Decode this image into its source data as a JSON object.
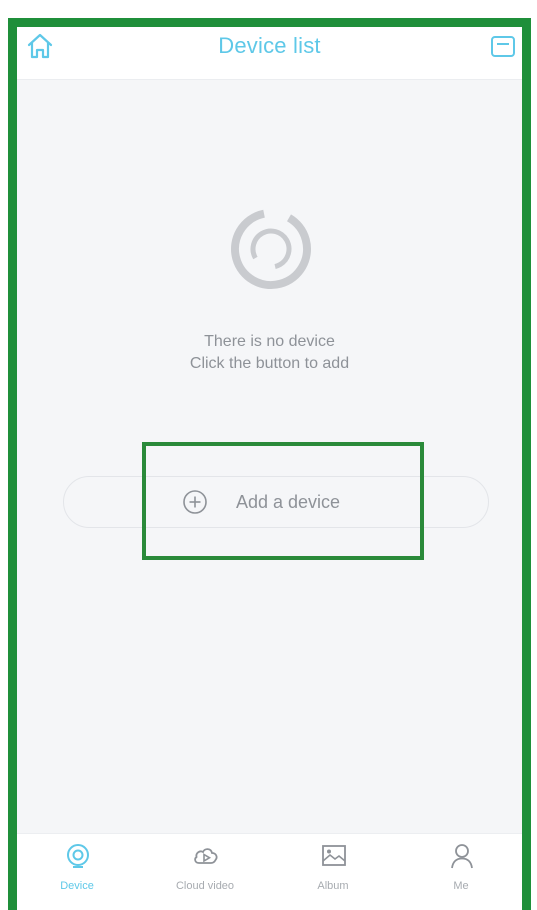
{
  "header": {
    "title": "Device list",
    "home_icon": "home-icon",
    "menu_icon": "menu-icon"
  },
  "empty_state": {
    "icon": "empty-device-icon",
    "line1": "There is no device",
    "line2": "Click the button to add"
  },
  "add_button": {
    "icon": "add-circle-icon",
    "label": "Add a device"
  },
  "tabs": [
    {
      "label": "Device",
      "icon": "device-camera-icon",
      "active": true
    },
    {
      "label": "Cloud video",
      "icon": "cloud-video-icon",
      "active": false
    },
    {
      "label": "Album",
      "icon": "album-icon",
      "active": false
    },
    {
      "label": "Me",
      "icon": "person-icon",
      "active": false
    }
  ],
  "colors": {
    "accent": "#5ec8e8",
    "highlight_border": "#1f8f3a",
    "muted_text": "#8e9298",
    "background": "#f5f6f8"
  }
}
